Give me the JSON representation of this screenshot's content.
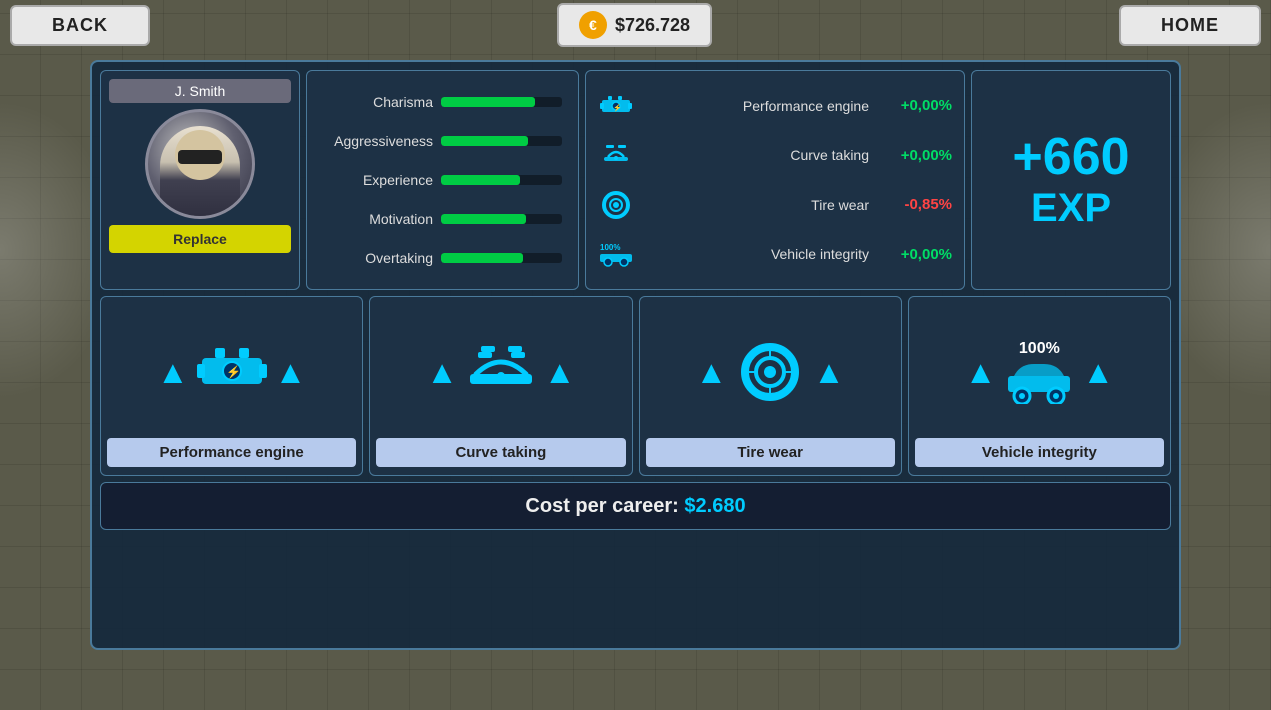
{
  "header": {
    "back_label": "BACK",
    "home_label": "HOME",
    "coin_symbol": "€",
    "balance": "$726.728"
  },
  "driver": {
    "name": "J. Smith",
    "replace_label": "Replace"
  },
  "stats": [
    {
      "label": "Charisma",
      "value": 78
    },
    {
      "label": "Aggressiveness",
      "value": 72
    },
    {
      "label": "Experience",
      "value": 65
    },
    {
      "label": "Motivation",
      "value": 70
    },
    {
      "label": "Overtaking",
      "value": 68
    }
  ],
  "performance": [
    {
      "label": "Performance engine",
      "value": "+0,00%",
      "color": "green"
    },
    {
      "label": "Curve taking",
      "value": "+0,00%",
      "color": "green"
    },
    {
      "label": "Tire wear",
      "value": "-0,85%",
      "color": "red"
    },
    {
      "label": "Vehicle integrity",
      "value": "+0,00%",
      "color": "green"
    }
  ],
  "exp": {
    "value": "+660",
    "label": "EXP"
  },
  "upgrades": [
    {
      "label": "Performance engine"
    },
    {
      "label": "Curve taking"
    },
    {
      "label": "Tire wear"
    },
    {
      "label": "Vehicle integrity"
    }
  ],
  "cost": {
    "label": "Cost per career:",
    "amount": "$2.680"
  }
}
